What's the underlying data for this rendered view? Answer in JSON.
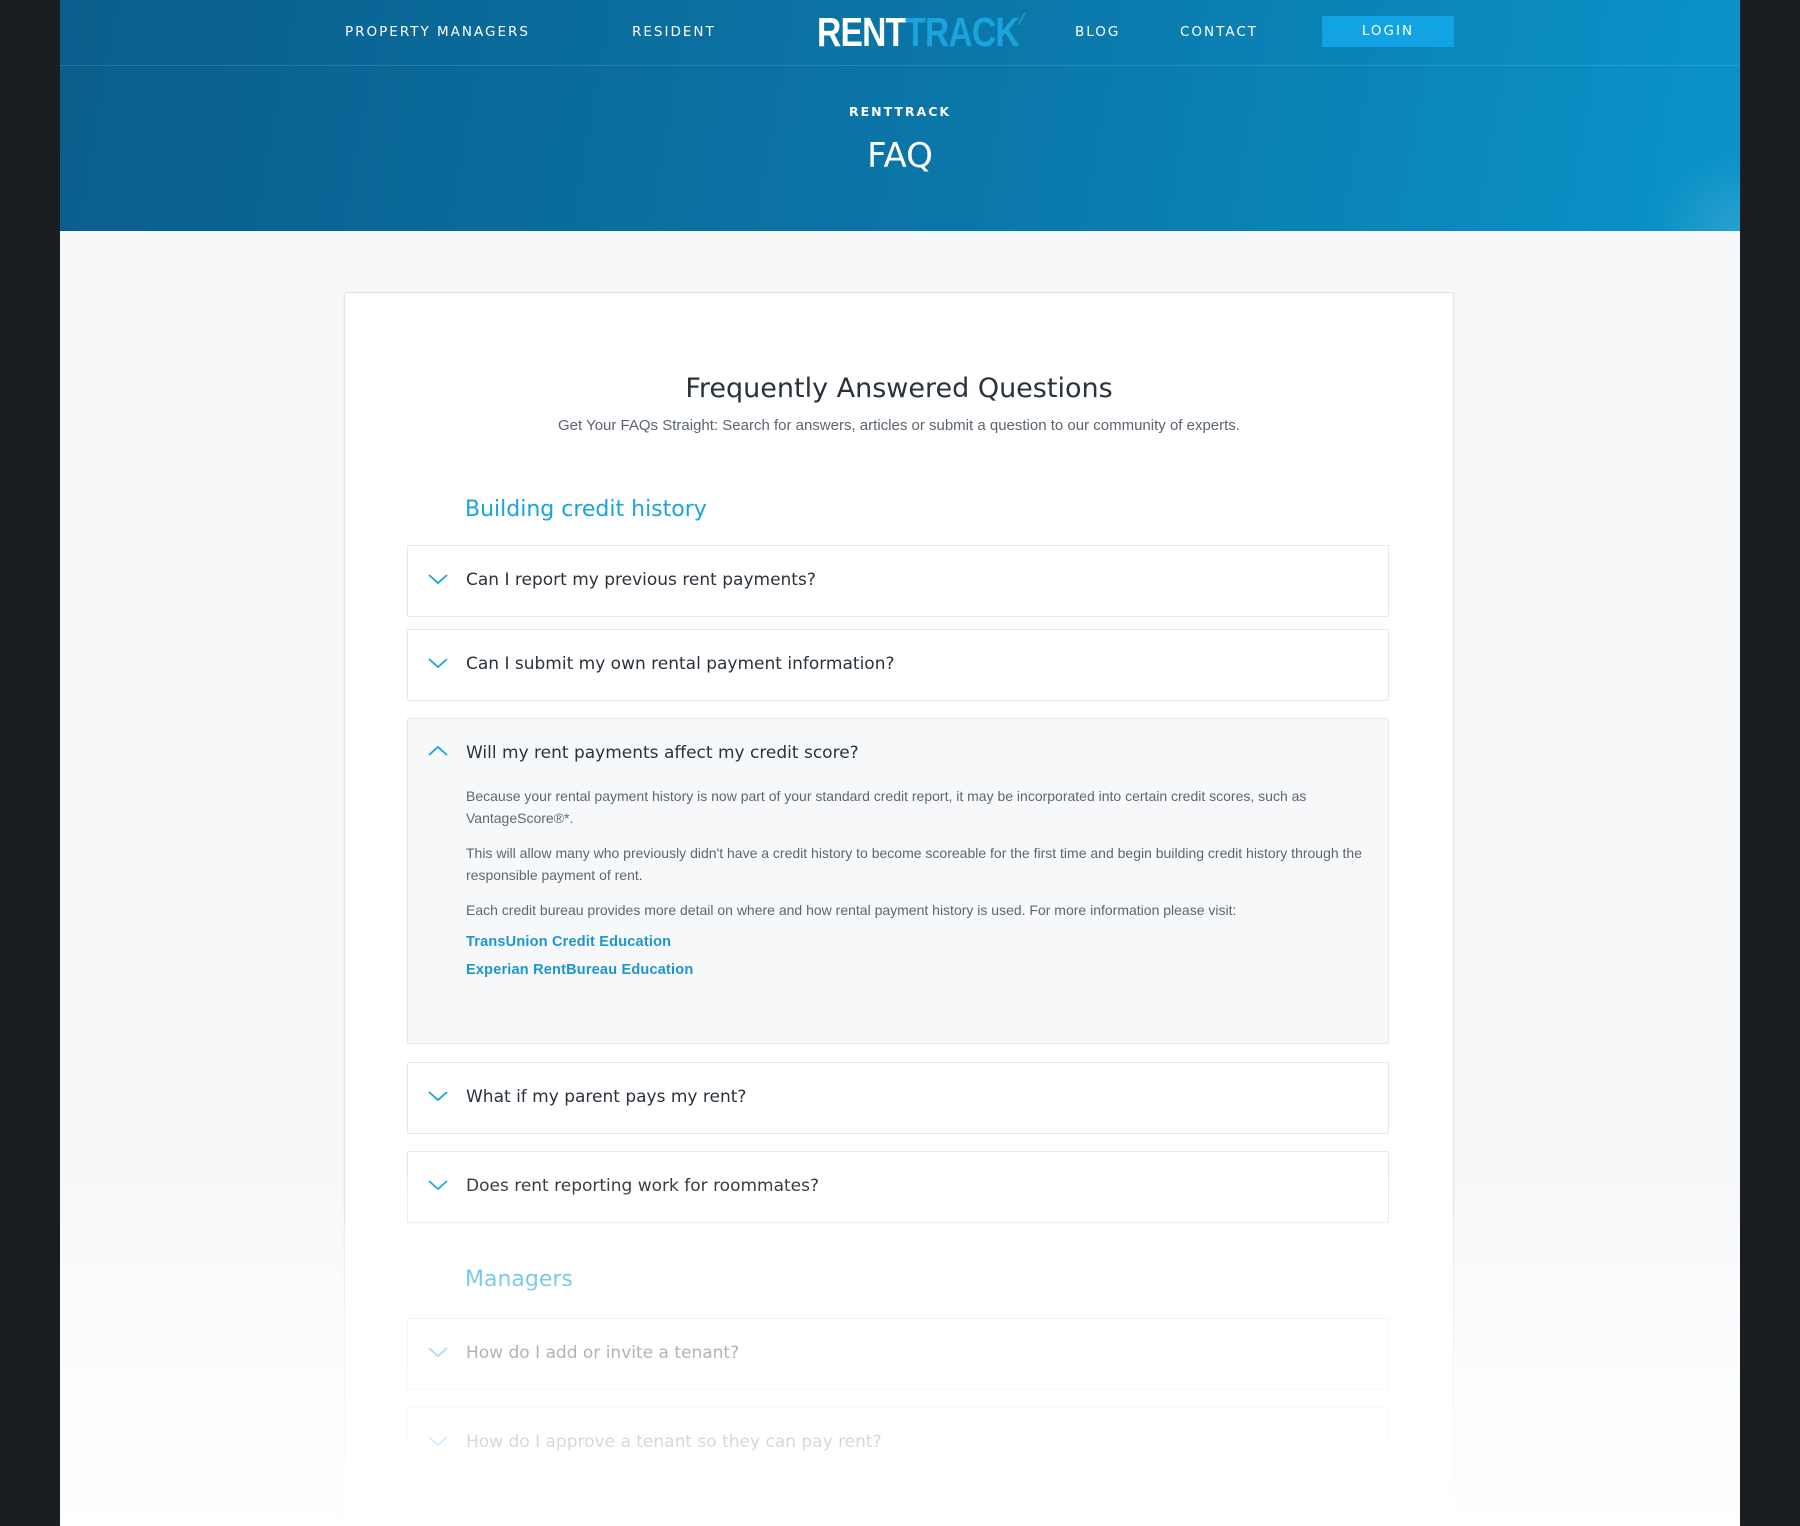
{
  "nav": {
    "property_managers": "PROPERTY MANAGERS",
    "resident": "RESIDENT",
    "logo_rent": "RENT",
    "logo_track": "TRACK",
    "blog": "BLOG",
    "contact": "CONTACT",
    "login": "LOGIN"
  },
  "hero": {
    "eyebrow": "RENTTRACK",
    "title": "FAQ"
  },
  "faq_card": {
    "title": "Frequently Answered Questions",
    "subtitle": "Get Your FAQs Straight: Search for answers, articles or submit a question to our community of experts."
  },
  "sections": [
    {
      "title": "Building credit history",
      "items": [
        {
          "question": "Can I report my previous rent payments?",
          "expanded": false
        },
        {
          "question": "Can I submit my own rental payment information?",
          "expanded": false
        },
        {
          "question": "Will my rent payments affect my credit score?",
          "expanded": true,
          "answer": [
            "Because your rental payment history is now part of your standard credit report, it may be incorporated into certain credit scores, such as VantageScore®*.",
            "This will allow many who previously didn't have a credit history to become scoreable for the first time and begin building credit history through the responsible payment of rent.",
            "Each credit bureau provides more detail on where and how rental payment history is used. For more information please visit:"
          ],
          "links": [
            "TransUnion Credit Education",
            "Experian RentBureau Education"
          ]
        },
        {
          "question": "What if my parent pays my rent?",
          "expanded": false
        },
        {
          "question": "Does rent reporting work for roommates?",
          "expanded": false
        }
      ]
    },
    {
      "title": "Managers",
      "items": [
        {
          "question": "How do I add or invite a tenant?",
          "expanded": false
        },
        {
          "question": "How do I approve a tenant so they can pay rent?",
          "expanded": false
        }
      ]
    }
  ],
  "colors": {
    "accent": "#1aa3dd",
    "login_button": "#12a3e4",
    "hero_gradient_start": "#0a5e8c",
    "hero_gradient_end": "#0a93c9",
    "body_text": "#2a323c"
  },
  "icons": {
    "collapsed": "chevron-down-icon",
    "expanded": "chevron-up-icon"
  }
}
